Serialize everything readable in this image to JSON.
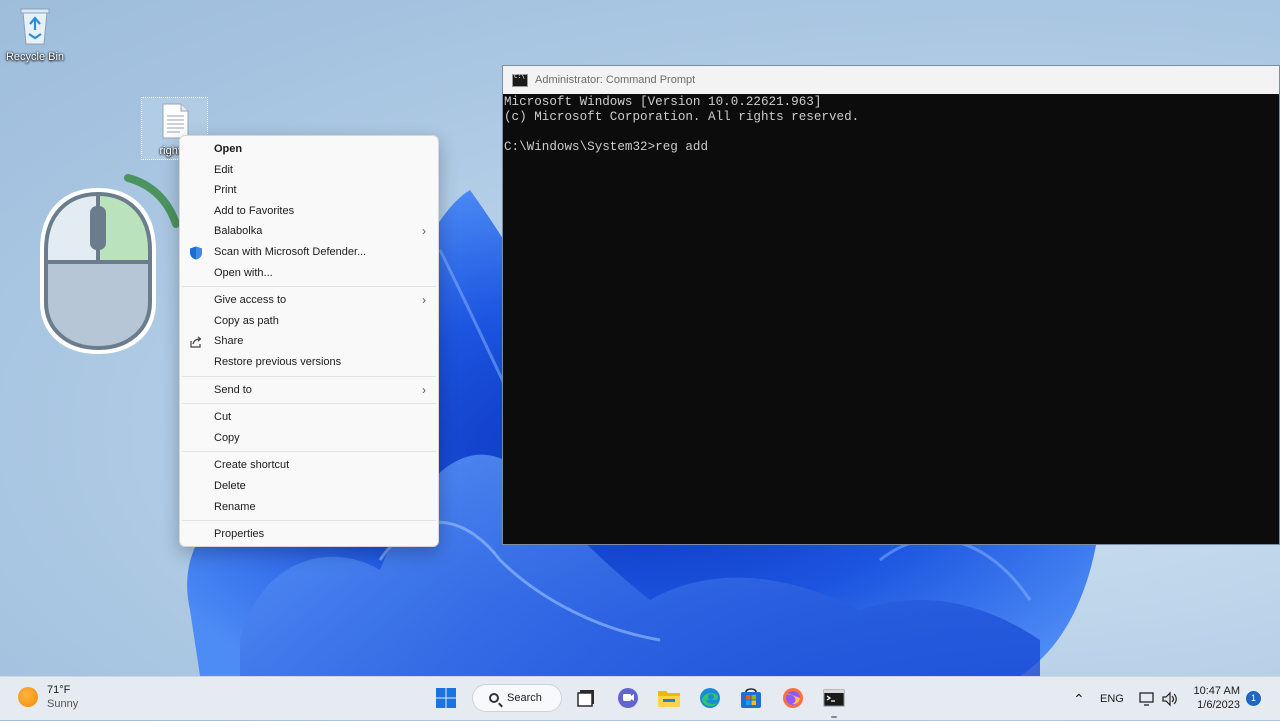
{
  "desktop": {
    "recycle_bin_label": "Recycle Bin",
    "selected_file_label": "right c"
  },
  "context_menu": {
    "items": [
      {
        "label": "Open",
        "bold": true
      },
      {
        "label": "Edit"
      },
      {
        "label": "Print"
      },
      {
        "label": "Add to Favorites"
      },
      {
        "label": "Balabolka",
        "submenu": true
      },
      {
        "label": "Scan with Microsoft Defender...",
        "icon": "defender-shield-icon"
      },
      {
        "label": "Open with..."
      },
      {
        "label": "Give access to",
        "submenu": true
      },
      {
        "label": "Copy as path"
      },
      {
        "label": "Share",
        "icon": "share-icon"
      },
      {
        "label": "Restore previous versions"
      },
      {
        "label": "Send to",
        "submenu": true
      },
      {
        "label": "Cut"
      },
      {
        "label": "Copy"
      },
      {
        "label": "Create shortcut"
      },
      {
        "label": "Delete"
      },
      {
        "label": "Rename"
      },
      {
        "label": "Properties"
      }
    ],
    "submenu_arrow": "›"
  },
  "cmd_window": {
    "title": "Administrator: Command Prompt",
    "lines": [
      "Microsoft Windows [Version 10.0.22621.963]",
      "(c) Microsoft Corporation. All rights reserved.",
      "",
      "C:\\Windows\\System32>reg add"
    ]
  },
  "taskbar": {
    "weather_temp": "71°F",
    "weather_desc": "Sunny",
    "search_label": "Search",
    "language": "ENG",
    "time": "10:47 AM",
    "date": "1/6/2023",
    "notification_count": "1"
  },
  "colors": {
    "accent": "#1f66c1",
    "console_bg": "#0c0c0c",
    "console_text": "#cccccc",
    "menu_bg": "#f9f9f9"
  }
}
